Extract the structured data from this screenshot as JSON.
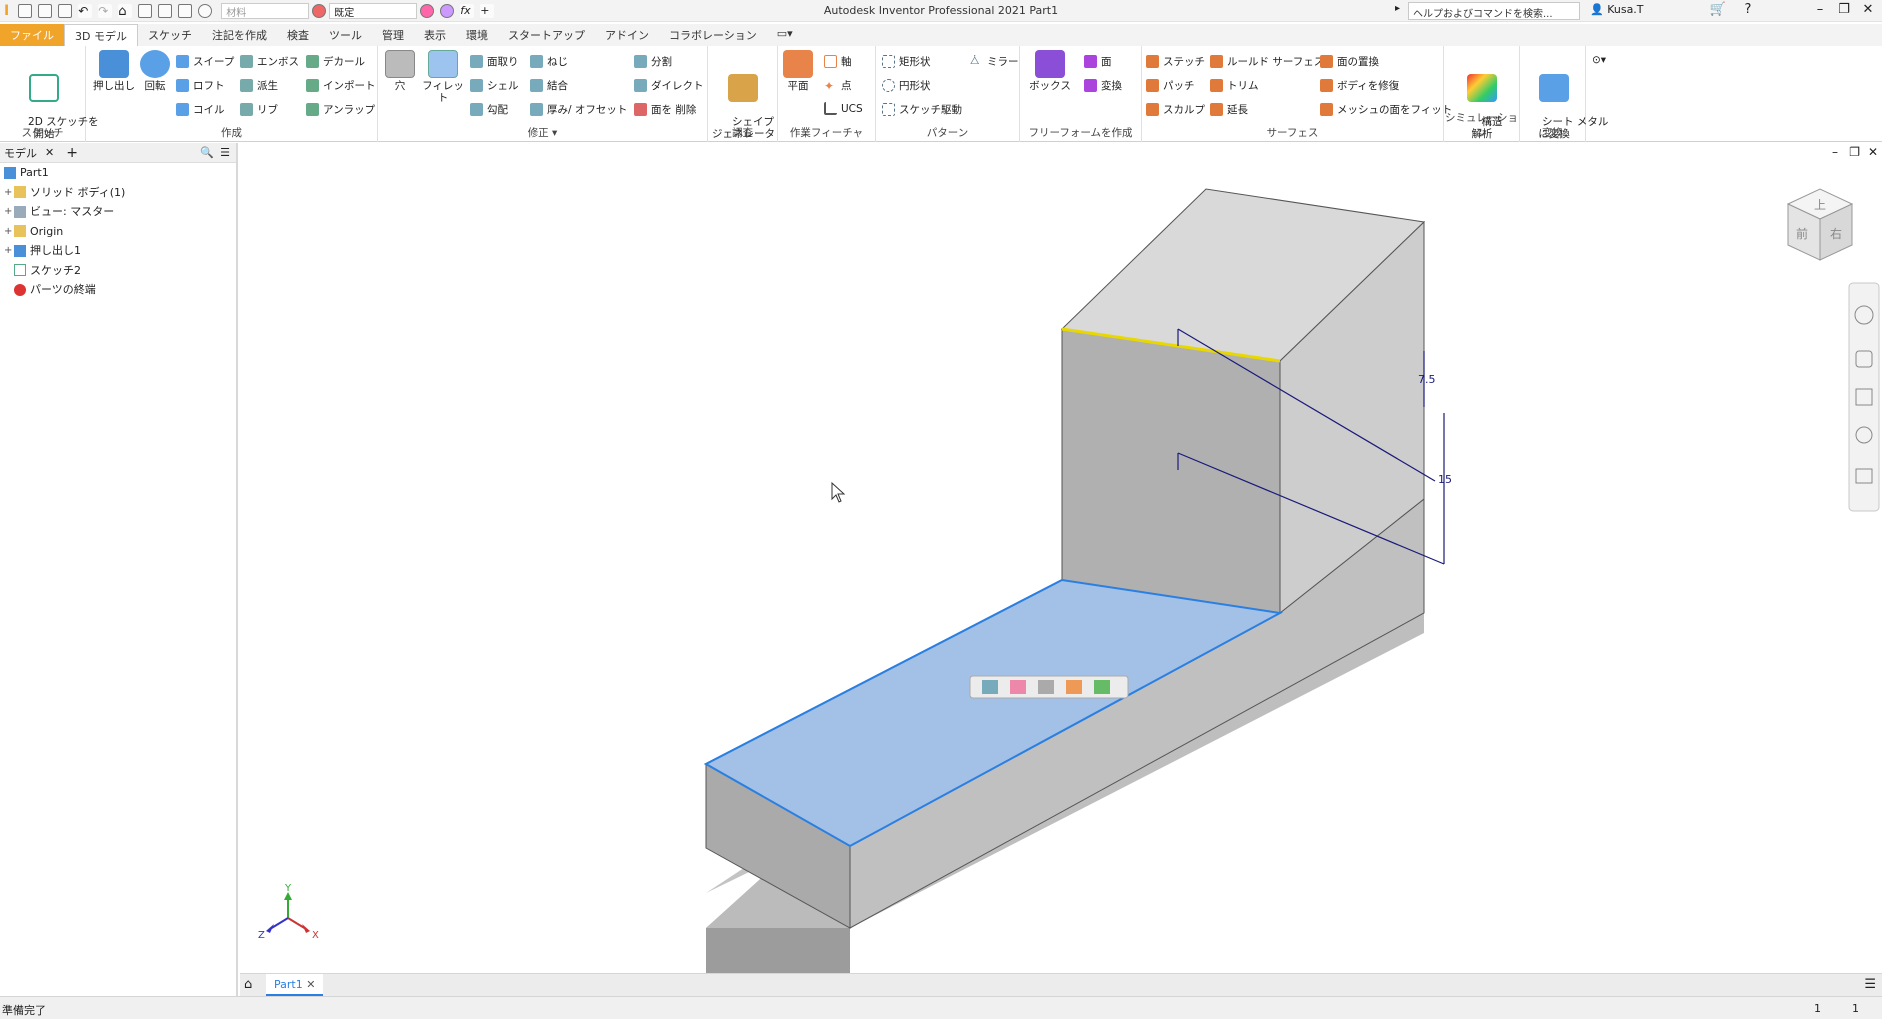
{
  "window": {
    "title": "Autodesk Inventor Professional 2021   Part1"
  },
  "quick_access": {
    "material_placeholder": "材料",
    "appearance": "既定"
  },
  "search": {
    "placeholder": "ヘルプおよびコマンドを検索..."
  },
  "user": {
    "name": "Kusa.T"
  },
  "tabs": [
    {
      "label": "ファイル"
    },
    {
      "label": "3D モデル"
    },
    {
      "label": "スケッチ"
    },
    {
      "label": "注記を作成"
    },
    {
      "label": "検査"
    },
    {
      "label": "ツール"
    },
    {
      "label": "管理"
    },
    {
      "label": "表示"
    },
    {
      "label": "環境"
    },
    {
      "label": "スタートアップ"
    },
    {
      "label": "アドイン"
    },
    {
      "label": "コラボレーション"
    }
  ],
  "ribbon": {
    "sketch": {
      "label": "スケッチ",
      "start": "2D スケッチを\n開始"
    },
    "create": {
      "label": "作成",
      "extrude": "押し出し",
      "revolve": "回転",
      "sweep": "スイープ",
      "loft": "ロフト",
      "coil": "コイル",
      "emboss": "エンボス",
      "derive": "派生",
      "rib": "リブ",
      "decal": "デカール",
      "import": "インポート",
      "unwrap": "アンラップ"
    },
    "modify": {
      "label": "修正",
      "hole": "穴",
      "fillet": "フィレット",
      "chamfer": "面取り",
      "shell": "シェル",
      "draft": "勾配",
      "thread": "ねじ",
      "combine": "結合",
      "thicken": "厚み/ オフセット",
      "split": "分割",
      "direct": "ダイレクト",
      "delete_face": "面を 削除"
    },
    "explore": {
      "label": "調査",
      "shape_gen": "シェイプ\nジェネレータ"
    },
    "work": {
      "label": "作業フィーチャ",
      "plane": "平面",
      "axis": "軸",
      "point": "点",
      "ucs": "UCS"
    },
    "pattern": {
      "label": "パターン",
      "rect": "矩形状",
      "circ": "円形状",
      "sketch_driven": "スケッチ駆動",
      "mirror": "ミラー"
    },
    "freeform": {
      "label": "フリーフォームを作成",
      "box": "ボックス",
      "face": "面",
      "convert": "変換"
    },
    "surface": {
      "label": "サーフェス",
      "stitch": "ステッチ",
      "patch": "パッチ",
      "sculpt": "スカルプ",
      "ruled": "ルールド サーフェス",
      "trim": "トリム",
      "extend": "延長",
      "replace_face": "面の置換",
      "repair": "ボディを修復",
      "fit_mesh": "メッシュの面をフィット"
    },
    "simulation": {
      "label": "シミュレーション",
      "stress": "構造\n解析"
    },
    "convert": {
      "label": "変換",
      "sheet_metal": "シート メタル\nに変換"
    }
  },
  "browser": {
    "tab_label": "モデル",
    "items": [
      {
        "label": "Part1",
        "icon": "part-icon"
      },
      {
        "label": "ソリッド ボディ(1)",
        "icon": "folder-icon"
      },
      {
        "label": "ビュー: マスター",
        "icon": "view-icon"
      },
      {
        "label": "Origin",
        "icon": "folder-icon"
      },
      {
        "label": "押し出し1",
        "icon": "extrude-icon"
      },
      {
        "label": "スケッチ2",
        "icon": "sketch-icon"
      },
      {
        "label": "パーツの終端",
        "icon": "end-of-part-icon"
      }
    ]
  },
  "dimensions": {
    "d1": "7.5",
    "d2": "15"
  },
  "viewcube": {
    "top": "上",
    "front": "前",
    "right": "右"
  },
  "triad": {
    "x": "X",
    "y": "Y",
    "z": "Z"
  },
  "doc_tab": {
    "label": "Part1"
  },
  "status": {
    "text": "準備完了",
    "n1": "1",
    "n2": "1"
  },
  "colors": {
    "file_tab": "#f0a42a",
    "selection_face": "#a3c0e6",
    "selection_edge": "#2a7fe0",
    "highlight_edge": "#e8d800",
    "dimension": "#1a1a7a"
  }
}
